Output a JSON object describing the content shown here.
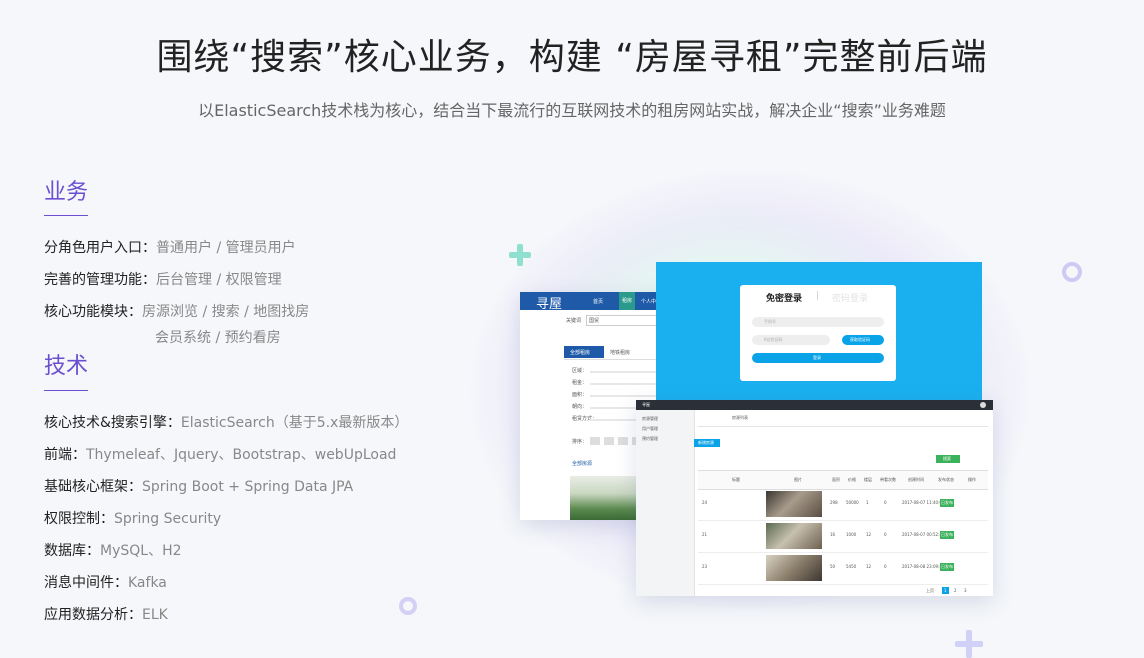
{
  "header": {
    "title": "围绕“搜索”核心业务，构建 “房屋寻租”完整前后端",
    "subtitle": "以ElasticSearch技术栈为核心，结合当下最流行的互联网技术的租房网站实战，解决企业“搜索”业务难题"
  },
  "business": {
    "heading": "业务",
    "items": [
      {
        "key": "分角色用户入口：",
        "value": "普通用户 / 管理员用户"
      },
      {
        "key": "完善的管理功能：",
        "value": "后台管理 / 权限管理"
      },
      {
        "key": "核心功能模块：",
        "value": "房源浏览 / 搜索 / 地图找房"
      },
      {
        "key": "",
        "value": "会员系统 / 预约看房"
      }
    ]
  },
  "tech": {
    "heading": "技术",
    "items": [
      {
        "key": "核心技术&搜索引擎：",
        "value": "ElasticSearch（基于5.x最新版本）"
      },
      {
        "key": "前端：",
        "value": "Thymeleaf、Jquery、Bootstrap、webUpLoad"
      },
      {
        "key": "基础核心框架：",
        "value": "Spring Boot + Spring Data JPA"
      },
      {
        "key": "权限控制：",
        "value": "Spring Security"
      },
      {
        "key": "数据库：",
        "value": "MySQL、H2"
      },
      {
        "key": "消息中间件：",
        "value": "Kafka"
      },
      {
        "key": "应用数据分析：",
        "value": "ELK"
      }
    ]
  },
  "screens": {
    "site": {
      "logo": "寻屋",
      "nav": [
        "首页",
        "租房",
        "个人中"
      ],
      "search_label": "关键词",
      "search_value": "国贸",
      "tabs": [
        "全部租房",
        "地铁租房"
      ],
      "filters": [
        "区域：",
        "租金：",
        "面积：",
        "朝向：",
        "租赁方式："
      ],
      "sort_label": "排序：",
      "section": "全部房源"
    },
    "login": {
      "tab_active": "免密登录",
      "tab_inactive": "密码登录",
      "phone_placeholder": "手机号",
      "code_placeholder": "6位验证码",
      "code_button": "获取验证码",
      "submit": "登录"
    },
    "admin": {
      "brand": "寻屋",
      "sidebar": [
        "房源管理",
        "用户管理",
        "预约管理"
      ],
      "page_title": "房源列表",
      "add_button": "新增房源",
      "search_button": "搜索",
      "columns": [
        "标题",
        "图片",
        "面积",
        "价格",
        "楼层",
        "带看次数",
        "创建时间",
        "发布状态",
        "操作"
      ],
      "rows": [
        {
          "id": "24",
          "area": "298",
          "price": "50000",
          "floor": "1",
          "watch": "0",
          "date": "2017-08-07 11:40:00",
          "status": "已发布"
        },
        {
          "id": "21",
          "area": "16",
          "price": "1000",
          "floor": "12",
          "watch": "0",
          "date": "2017-08-07 00:52:47",
          "status": "已发布"
        },
        {
          "id": "23",
          "area": "50",
          "price": "5450",
          "floor": "12",
          "watch": "0",
          "date": "2017-08-08 23:09:40",
          "status": "已发布"
        }
      ],
      "pagination": [
        "上页",
        "1",
        "2",
        "3"
      ]
    }
  },
  "colors": {
    "accent": "#6b4fd0",
    "login_bg": "#1ab0ef",
    "button_blue": "#0aa3e8",
    "status_green": "#3cb25c"
  }
}
